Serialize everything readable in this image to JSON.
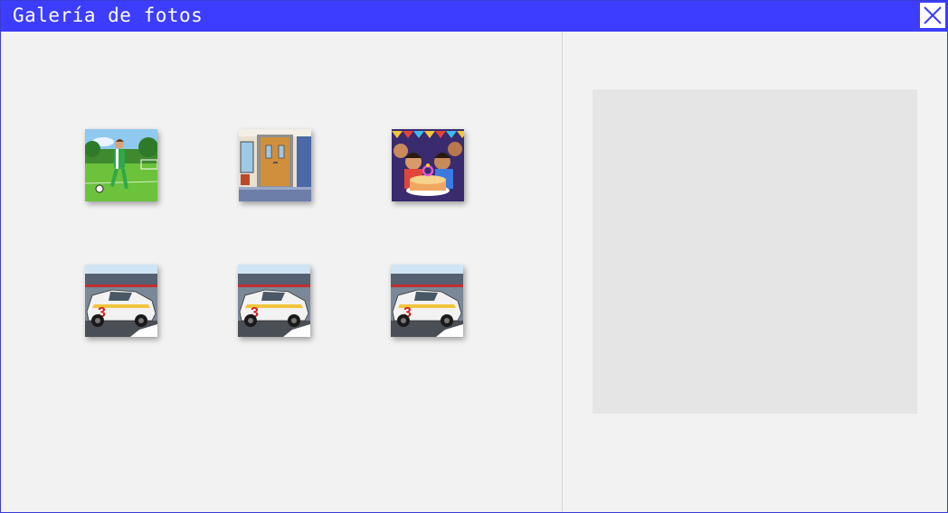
{
  "window": {
    "title": "Galería de fotos",
    "colors": {
      "titlebar": "#3d3dff",
      "background": "#f2f2f2",
      "preview": "#e5e5e5"
    },
    "close_icon": "close-icon"
  },
  "gallery": {
    "photos": [
      {
        "subject": "soccer-player"
      },
      {
        "subject": "school-door"
      },
      {
        "subject": "birthday-party"
      },
      {
        "subject": "race-car-3"
      },
      {
        "subject": "race-car-3"
      },
      {
        "subject": "race-car-3"
      }
    ]
  }
}
